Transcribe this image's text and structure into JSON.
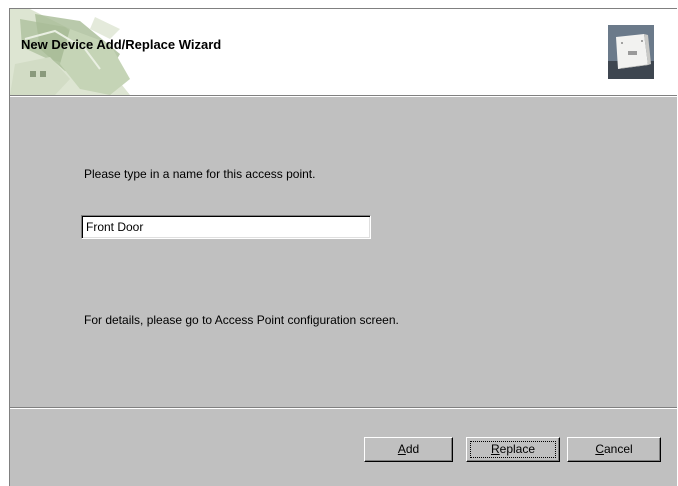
{
  "header": {
    "title": "New Device Add/Replace Wizard",
    "left_graphic_icon": "house-silhouette-icon",
    "right_image_icon": "access-point-device-icon"
  },
  "body": {
    "prompt": "Please type in a name for this access point.",
    "name_input_value": "Front Door",
    "details_text": "For details, please go to Access Point configuration screen."
  },
  "buttons": {
    "add_accel": "A",
    "add_rest": "dd",
    "replace_accel": "R",
    "replace_rest": "eplace",
    "cancel_accel": "C",
    "cancel_rest": "ancel"
  },
  "colors": {
    "dialog_face": "#c0c0c0",
    "header_background": "#ffffff",
    "shadow": "#808080"
  }
}
